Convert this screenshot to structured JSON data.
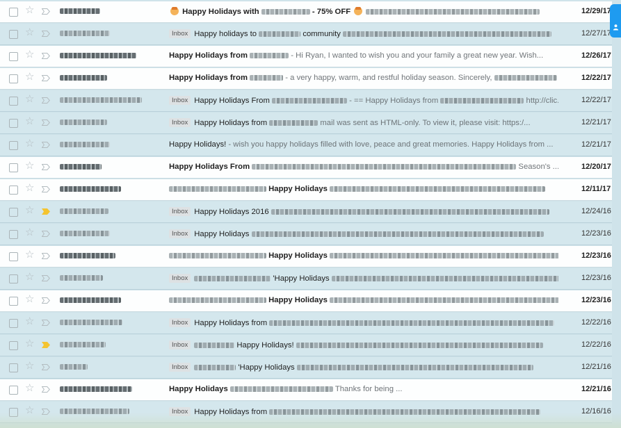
{
  "inbox_label": "Inbox",
  "side_tab": {
    "icon": "person-icon",
    "color": "#1e9bf0"
  },
  "rows": [
    {
      "read": false,
      "important": false,
      "sender_w": 58,
      "inbox": false,
      "subject": "Happy Holidays with",
      "subject_blur": 70,
      "subject_tail": "- 75% OFF",
      "snippet": "",
      "snippet_blur": 250,
      "emoji": true,
      "date": "12/29/17"
    },
    {
      "read": true,
      "important": false,
      "sender_w": 72,
      "inbox": true,
      "subject": "Happy holidays to",
      "subject_blur": 60,
      "subject_tail": "community",
      "snippet": "",
      "snippet_blur": 300,
      "date": "12/27/17"
    },
    {
      "read": false,
      "important": false,
      "sender_w": 110,
      "inbox": false,
      "subject": "Happy Holidays from",
      "subject_blur": 56,
      "subject_tail": "",
      "snippet": "- Hi Ryan, I wanted to wish you and your family a great new year. Wish...",
      "snippet_blur": 0,
      "date": "12/26/17"
    },
    {
      "read": false,
      "important": false,
      "sender_w": 68,
      "inbox": false,
      "subject": "Happy Holidays from",
      "subject_blur": 48,
      "subject_tail": "",
      "snippet": "- a very happy, warm, and restful holiday season. Sincerely,",
      "snippet_blur": 90,
      "date": "12/22/17"
    },
    {
      "read": true,
      "important": false,
      "sender_w": 118,
      "inbox": true,
      "subject": "Happy Holidays From",
      "subject_blur": 108,
      "subject_tail": "",
      "snippet": "- == Happy Holidays from",
      "snippet_blur": 120,
      "snippet_tail": "http://clic...",
      "date": "12/22/17"
    },
    {
      "read": true,
      "important": false,
      "sender_w": 68,
      "inbox": true,
      "subject": "Happy Holidays from",
      "subject_blur": 70,
      "subject_tail": "",
      "snippet": "mail was sent as HTML-only. To view it, please visit: https:/...",
      "snippet_blur": 0,
      "date": "12/21/17"
    },
    {
      "read": true,
      "important": false,
      "sender_w": 72,
      "inbox": false,
      "subject": "Happy Holidays!",
      "subject_blur": 0,
      "subject_tail": "",
      "snippet": "- wish you happy holidays filled with love, peace and great memories. Happy Holidays from ...",
      "snippet_blur": 0,
      "date": "12/21/17"
    },
    {
      "read": false,
      "important": false,
      "sender_w": 60,
      "inbox": false,
      "subject": "Happy Holidays From",
      "subject_blur": 380,
      "subject_tail": "",
      "snippet": "Season's ...",
      "snippet_blur": 0,
      "date": "12/20/17"
    },
    {
      "read": false,
      "important": false,
      "sender_w": 88,
      "inbox": false,
      "lead_blur": 140,
      "subject": "Happy Holidays",
      "subject_blur": 0,
      "subject_tail": "",
      "snippet": "",
      "snippet_blur": 310,
      "date": "12/11/17"
    },
    {
      "read": true,
      "important": true,
      "sender_w": 70,
      "inbox": true,
      "subject": "Happy Holidays 2016",
      "subject_blur": 0,
      "subject_tail": "",
      "snippet": "",
      "snippet_blur": 400,
      "date": "12/24/16"
    },
    {
      "read": true,
      "important": false,
      "sender_w": 72,
      "inbox": true,
      "subject": "Happy Holidays",
      "subject_blur": 0,
      "subject_tail": "",
      "snippet": "",
      "snippet_blur": 420,
      "date": "12/23/16"
    },
    {
      "read": false,
      "important": false,
      "sender_w": 80,
      "inbox": false,
      "lead_blur": 140,
      "subject": "Happy Holidays",
      "subject_blur": 0,
      "subject_tail": "",
      "snippet": "",
      "snippet_blur": 330,
      "date": "12/23/16"
    },
    {
      "read": true,
      "important": false,
      "sender_w": 62,
      "inbox": true,
      "lead_blur": 110,
      "subject": "'Happy Holidays",
      "subject_blur": 0,
      "subject_tail": "",
      "snippet": "",
      "snippet_blur": 330,
      "date": "12/23/16"
    },
    {
      "read": false,
      "important": false,
      "sender_w": 88,
      "inbox": false,
      "lead_blur": 140,
      "subject": "Happy Holidays",
      "subject_blur": 0,
      "subject_tail": "",
      "snippet": "",
      "snippet_blur": 330,
      "date": "12/23/16"
    },
    {
      "read": true,
      "important": false,
      "sender_w": 90,
      "inbox": true,
      "subject": "Happy Holidays from",
      "subject_blur": 0,
      "subject_tail": "",
      "snippet": "",
      "snippet_blur": 410,
      "date": "12/22/16"
    },
    {
      "read": true,
      "important": true,
      "sender_w": 66,
      "inbox": true,
      "lead_blur": 58,
      "subject": "Happy Holidays!",
      "subject_blur": 0,
      "subject_tail": "",
      "snippet": "",
      "snippet_blur": 355,
      "date": "12/22/16"
    },
    {
      "read": true,
      "important": false,
      "sender_w": 40,
      "inbox": true,
      "lead_blur": 60,
      "subject": "'Happy Holidays",
      "subject_blur": 0,
      "subject_tail": "",
      "snippet": "",
      "snippet_blur": 340,
      "date": "12/21/16"
    },
    {
      "read": false,
      "important": false,
      "sender_w": 104,
      "inbox": false,
      "subject": "Happy Holidays",
      "subject_blur": 148,
      "subject_tail": "",
      "snippet": "Thanks for being ...",
      "snippet_blur": 0,
      "date": "12/21/16"
    },
    {
      "read": true,
      "important": false,
      "sender_w": 100,
      "inbox": true,
      "subject": "Happy Holidays from",
      "subject_blur": 0,
      "subject_tail": "",
      "snippet": "",
      "snippet_blur": 390,
      "date": "12/16/16"
    }
  ]
}
